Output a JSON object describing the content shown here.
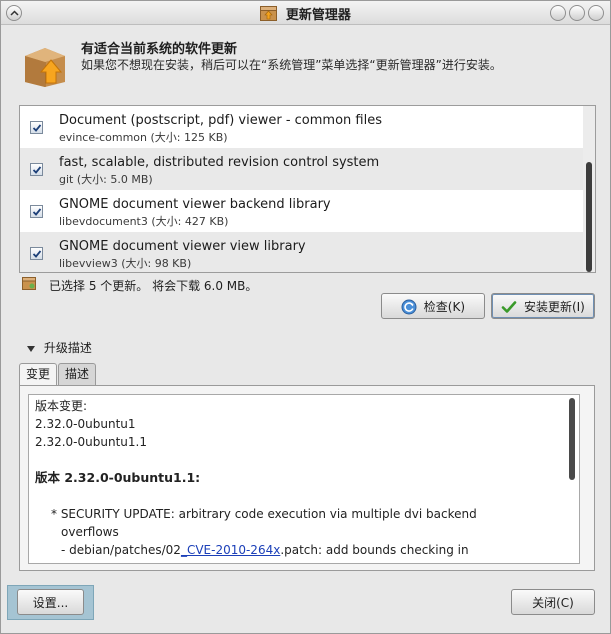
{
  "window": {
    "title": "更新管理器"
  },
  "header": {
    "title": "有适合当前系统的软件更新",
    "subtitle": "如果您不想现在安装，稍后可以在“系统管理”菜单选择“更新管理器”进行安装。"
  },
  "updates": [
    {
      "title": "Document (postscript, pdf) viewer - common files",
      "detail": "evince-common (大小: 125 KB)",
      "checked": true
    },
    {
      "title": "fast, scalable, distributed revision control system",
      "detail": "git (大小: 5.0 MB)",
      "checked": true
    },
    {
      "title": "GNOME document viewer backend library",
      "detail": "libevdocument3 (大小: 427 KB)",
      "checked": true
    },
    {
      "title": "GNOME document viewer view library",
      "detail": "libevview3 (大小: 98 KB)",
      "checked": true
    }
  ],
  "status": {
    "text": "已选择 5 个更新。 将会下载 6.0 MB。"
  },
  "buttons": {
    "check": "检查(K)",
    "install": "安装更新(I)",
    "settings": "设置...",
    "close": "关闭(C)"
  },
  "expander": {
    "label": "升级描述"
  },
  "tabs": {
    "changes": "变更",
    "description": "描述"
  },
  "changes": {
    "header": "版本变更:",
    "version_a": "2.32.0-0ubuntu1",
    "version_b": "2.32.0-0ubuntu1.1",
    "version_heading": "版本 2.32.0-0ubuntu1.1:",
    "line1": "* SECURITY UPDATE: arbitrary code execution via multiple dvi backend",
    "line2": "overflows",
    "line3_prefix": "- debian/patches/02",
    "line3_link": "_CVE-2010-264x",
    "line3_suffix": ".patch: add bounds checking in"
  },
  "colors": {
    "window_bg": "#e8e8e8",
    "list_alt_row": "#e9e9e9",
    "link": "#1b3fb8",
    "focus_highlight": "#a5c4d3"
  },
  "icons": {
    "menu": "chevron-up-icon",
    "app": "package-update-icon",
    "header": "package-upgrade-icon",
    "status": "package-icon",
    "check": "refresh-icon",
    "install": "checkmark-icon",
    "checkbox": "checkmark-icon",
    "expander": "triangle-down-icon"
  }
}
